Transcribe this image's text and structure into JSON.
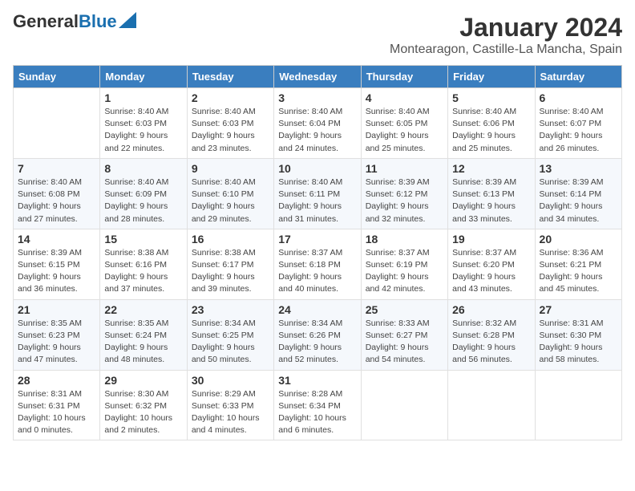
{
  "header": {
    "logo_general": "General",
    "logo_blue": "Blue",
    "month_title": "January 2024",
    "location": "Montearagon, Castille-La Mancha, Spain"
  },
  "days_of_week": [
    "Sunday",
    "Monday",
    "Tuesday",
    "Wednesday",
    "Thursday",
    "Friday",
    "Saturday"
  ],
  "weeks": [
    [
      {
        "day": "",
        "info": ""
      },
      {
        "day": "1",
        "info": "Sunrise: 8:40 AM\nSunset: 6:03 PM\nDaylight: 9 hours\nand 22 minutes."
      },
      {
        "day": "2",
        "info": "Sunrise: 8:40 AM\nSunset: 6:03 PM\nDaylight: 9 hours\nand 23 minutes."
      },
      {
        "day": "3",
        "info": "Sunrise: 8:40 AM\nSunset: 6:04 PM\nDaylight: 9 hours\nand 24 minutes."
      },
      {
        "day": "4",
        "info": "Sunrise: 8:40 AM\nSunset: 6:05 PM\nDaylight: 9 hours\nand 25 minutes."
      },
      {
        "day": "5",
        "info": "Sunrise: 8:40 AM\nSunset: 6:06 PM\nDaylight: 9 hours\nand 25 minutes."
      },
      {
        "day": "6",
        "info": "Sunrise: 8:40 AM\nSunset: 6:07 PM\nDaylight: 9 hours\nand 26 minutes."
      }
    ],
    [
      {
        "day": "7",
        "info": ""
      },
      {
        "day": "8",
        "info": "Sunrise: 8:40 AM\nSunset: 6:09 PM\nDaylight: 9 hours\nand 28 minutes."
      },
      {
        "day": "9",
        "info": "Sunrise: 8:40 AM\nSunset: 6:10 PM\nDaylight: 9 hours\nand 29 minutes."
      },
      {
        "day": "10",
        "info": "Sunrise: 8:40 AM\nSunset: 6:11 PM\nDaylight: 9 hours\nand 31 minutes."
      },
      {
        "day": "11",
        "info": "Sunrise: 8:39 AM\nSunset: 6:12 PM\nDaylight: 9 hours\nand 32 minutes."
      },
      {
        "day": "12",
        "info": "Sunrise: 8:39 AM\nSunset: 6:13 PM\nDaylight: 9 hours\nand 33 minutes."
      },
      {
        "day": "13",
        "info": "Sunrise: 8:39 AM\nSunset: 6:14 PM\nDaylight: 9 hours\nand 34 minutes."
      }
    ],
    [
      {
        "day": "14",
        "info": ""
      },
      {
        "day": "15",
        "info": "Sunrise: 8:38 AM\nSunset: 6:16 PM\nDaylight: 9 hours\nand 37 minutes."
      },
      {
        "day": "16",
        "info": "Sunrise: 8:38 AM\nSunset: 6:17 PM\nDaylight: 9 hours\nand 39 minutes."
      },
      {
        "day": "17",
        "info": "Sunrise: 8:37 AM\nSunset: 6:18 PM\nDaylight: 9 hours\nand 40 minutes."
      },
      {
        "day": "18",
        "info": "Sunrise: 8:37 AM\nSunset: 6:19 PM\nDaylight: 9 hours\nand 42 minutes."
      },
      {
        "day": "19",
        "info": "Sunrise: 8:37 AM\nSunset: 6:20 PM\nDaylight: 9 hours\nand 43 minutes."
      },
      {
        "day": "20",
        "info": "Sunrise: 8:36 AM\nSunset: 6:21 PM\nDaylight: 9 hours\nand 45 minutes."
      }
    ],
    [
      {
        "day": "21",
        "info": ""
      },
      {
        "day": "22",
        "info": "Sunrise: 8:35 AM\nSunset: 6:24 PM\nDaylight: 9 hours\nand 48 minutes."
      },
      {
        "day": "23",
        "info": "Sunrise: 8:34 AM\nSunset: 6:25 PM\nDaylight: 9 hours\nand 50 minutes."
      },
      {
        "day": "24",
        "info": "Sunrise: 8:34 AM\nSunset: 6:26 PM\nDaylight: 9 hours\nand 52 minutes."
      },
      {
        "day": "25",
        "info": "Sunrise: 8:33 AM\nSunset: 6:27 PM\nDaylight: 9 hours\nand 54 minutes."
      },
      {
        "day": "26",
        "info": "Sunrise: 8:32 AM\nSunset: 6:28 PM\nDaylight: 9 hours\nand 56 minutes."
      },
      {
        "day": "27",
        "info": "Sunrise: 8:31 AM\nSunset: 6:30 PM\nDaylight: 9 hours\nand 58 minutes."
      }
    ],
    [
      {
        "day": "28",
        "info": "Sunrise: 8:31 AM\nSunset: 6:31 PM\nDaylight: 10 hours\nand 0 minutes."
      },
      {
        "day": "29",
        "info": "Sunrise: 8:30 AM\nSunset: 6:32 PM\nDaylight: 10 hours\nand 2 minutes."
      },
      {
        "day": "30",
        "info": "Sunrise: 8:29 AM\nSunset: 6:33 PM\nDaylight: 10 hours\nand 4 minutes."
      },
      {
        "day": "31",
        "info": "Sunrise: 8:28 AM\nSunset: 6:34 PM\nDaylight: 10 hours\nand 6 minutes."
      },
      {
        "day": "",
        "info": ""
      },
      {
        "day": "",
        "info": ""
      },
      {
        "day": "",
        "info": ""
      }
    ]
  ],
  "week1_sun_info": "Sunrise: 8:40 AM\nSunset: 6:08 PM\nDaylight: 9 hours\nand 27 minutes.",
  "week3_sun_info": "Sunrise: 8:39 AM\nSunset: 6:15 PM\nDaylight: 9 hours\nand 36 minutes.",
  "week4_sun_info": "Sunrise: 8:35 AM\nSunset: 6:23 PM\nDaylight: 9 hours\nand 47 minutes."
}
